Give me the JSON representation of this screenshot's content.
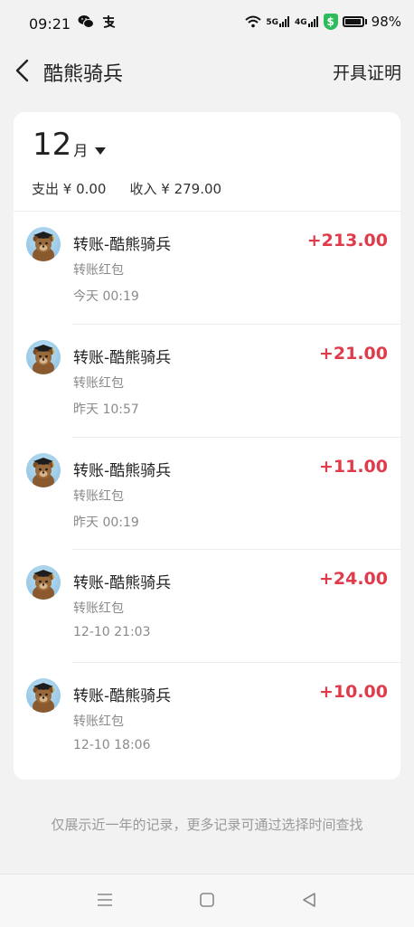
{
  "status_bar": {
    "time": "09:21",
    "battery": "98%",
    "network_5g": "5G",
    "network_4g": "4G"
  },
  "header": {
    "title": "酷熊骑兵",
    "action_label": "开具证明"
  },
  "summary": {
    "month_number": "12",
    "month_unit": "月",
    "expense": "支出 ¥ 0.00",
    "income": "收入 ¥ 279.00"
  },
  "transactions": [
    {
      "title": "转账-酷熊骑兵",
      "type": "转账红包",
      "time": "今天 00:19",
      "amount": "+213.00"
    },
    {
      "title": "转账-酷熊骑兵",
      "type": "转账红包",
      "time": "昨天 10:57",
      "amount": "+21.00"
    },
    {
      "title": "转账-酷熊骑兵",
      "type": "转账红包",
      "time": "昨天 00:19",
      "amount": "+11.00"
    },
    {
      "title": "转账-酷熊骑兵",
      "type": "转账红包",
      "time": "12-10 21:03",
      "amount": "+24.00"
    },
    {
      "title": "转账-酷熊骑兵",
      "type": "转账红包",
      "time": "12-10 18:06",
      "amount": "+10.00"
    }
  ],
  "footer_note": "仅展示近一年的记录，更多记录可通过选择时间查找",
  "colors": {
    "income_amount": "#e03b4b",
    "background": "#f2f2f2",
    "card": "#ffffff"
  }
}
